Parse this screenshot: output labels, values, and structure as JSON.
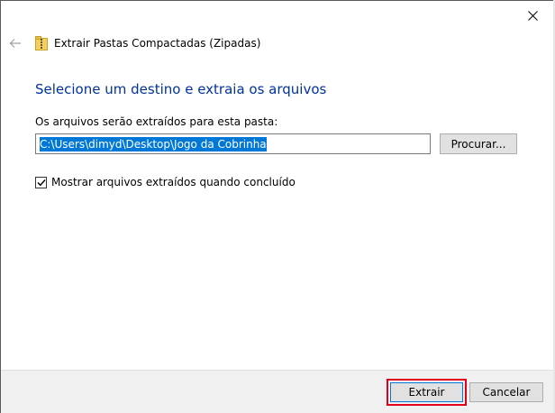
{
  "window": {
    "close_icon": "close-icon"
  },
  "header": {
    "back_icon": "back-arrow-icon",
    "app_icon": "zip-folder-icon",
    "title": "Extrair Pastas Compactadas (Zipadas)"
  },
  "main": {
    "instruction": "Selecione um destino e extraia os arquivos",
    "folder_label": "Os arquivos serão extraídos para esta pasta:",
    "path_value": "C:\\Users\\dimyd\\Desktop\\Jogo da Cobrinha",
    "browse_label": "Procurar...",
    "show_files_checked": true,
    "show_files_label": "Mostrar arquivos extraídos quando concluído"
  },
  "footer": {
    "extract_label": "Extrair",
    "cancel_label": "Cancelar"
  },
  "colors": {
    "instruction": "#003399",
    "selection": "#0078d7",
    "highlight": "#e1001a"
  }
}
